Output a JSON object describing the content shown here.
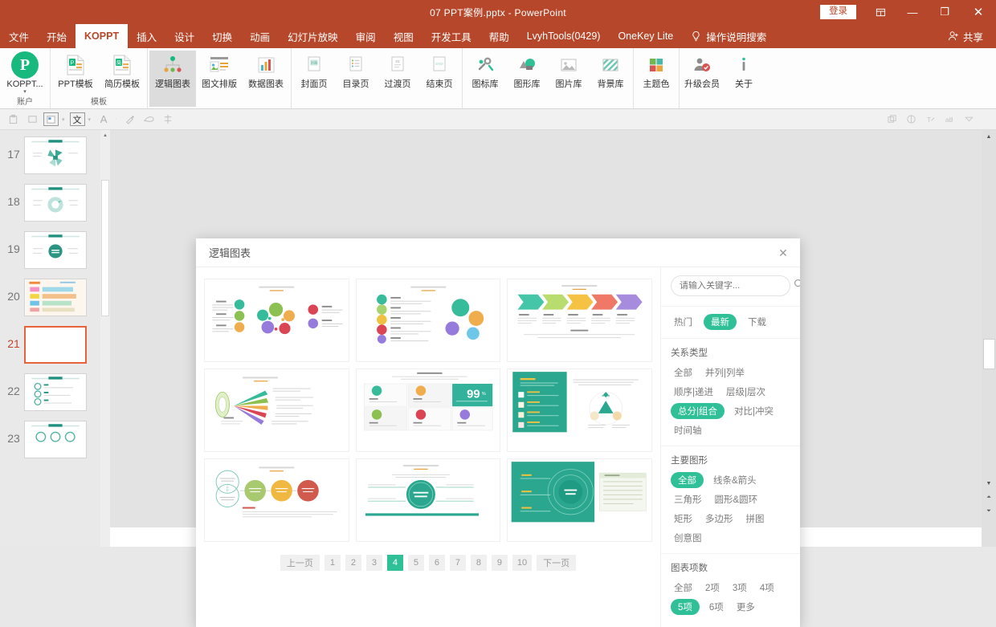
{
  "titlebar": {
    "document_title": "07  PPT案例.pptx  -  PowerPoint",
    "signin_label": "登录",
    "restore_icon": "restore-down-icon",
    "minimize_label": "—",
    "maximize_label": "❐",
    "close_label": "✕"
  },
  "menubar": {
    "items": [
      {
        "label": "文件",
        "active": false
      },
      {
        "label": "开始",
        "active": false
      },
      {
        "label": "KOPPT",
        "active": true
      },
      {
        "label": "插入",
        "active": false
      },
      {
        "label": "设计",
        "active": false
      },
      {
        "label": "切换",
        "active": false
      },
      {
        "label": "动画",
        "active": false
      },
      {
        "label": "幻灯片放映",
        "active": false
      },
      {
        "label": "审阅",
        "active": false
      },
      {
        "label": "视图",
        "active": false
      },
      {
        "label": "开发工具",
        "active": false
      },
      {
        "label": "帮助",
        "active": false
      },
      {
        "label": "LvyhTools(0429)",
        "active": false
      },
      {
        "label": "OneKey Lite",
        "active": false
      }
    ],
    "tell_me": "操作说明搜索",
    "tell_me_icon": "lightbulb-icon",
    "share_label": "共享",
    "share_icon": "share-person-icon"
  },
  "ribbon": {
    "groups": [
      {
        "label": "账户",
        "buttons": [
          {
            "label": "KOPPT...",
            "icon": "koppt-logo-icon",
            "has_caret": true,
            "selected": false
          }
        ]
      },
      {
        "label": "模板",
        "buttons": [
          {
            "label": "PPT模板",
            "icon": "ppt-template-icon",
            "selected": false
          },
          {
            "label": "简历模板",
            "icon": "resume-template-icon",
            "selected": false
          }
        ]
      },
      {
        "label": "",
        "buttons": [
          {
            "label": "逻辑图表",
            "icon": "logic-chart-icon",
            "selected": true
          },
          {
            "label": "图文排版",
            "icon": "text-image-layout-icon",
            "selected": false
          },
          {
            "label": "数据图表",
            "icon": "data-chart-icon",
            "selected": false
          }
        ]
      },
      {
        "label": "",
        "buttons": [
          {
            "label": "封面页",
            "icon": "cover-page-icon",
            "selected": false
          },
          {
            "label": "目录页",
            "icon": "toc-page-icon",
            "selected": false
          },
          {
            "label": "过渡页",
            "icon": "transition-page-icon",
            "selected": false
          },
          {
            "label": "结束页",
            "icon": "end-page-icon",
            "selected": false
          }
        ]
      },
      {
        "label": "",
        "buttons": [
          {
            "label": "图标库",
            "icon": "icon-library-icon",
            "selected": false
          },
          {
            "label": "图形库",
            "icon": "shape-library-icon",
            "selected": false
          },
          {
            "label": "图片库",
            "icon": "image-library-icon",
            "selected": false
          },
          {
            "label": "背景库",
            "icon": "background-library-icon",
            "selected": false
          }
        ]
      },
      {
        "label": "",
        "buttons": [
          {
            "label": "主题色",
            "icon": "theme-color-icon",
            "selected": false
          }
        ]
      },
      {
        "label": "",
        "buttons": [
          {
            "label": "升级会员",
            "icon": "upgrade-member-icon",
            "selected": false
          },
          {
            "label": "关于",
            "icon": "about-info-icon",
            "selected": false
          }
        ]
      }
    ]
  },
  "slides": [
    {
      "number": "17",
      "active": false,
      "style": "pie"
    },
    {
      "number": "18",
      "active": false,
      "style": "donut"
    },
    {
      "number": "19",
      "active": false,
      "style": "circle"
    },
    {
      "number": "20",
      "active": false,
      "style": "colorlist"
    },
    {
      "number": "21",
      "active": true,
      "style": "blank"
    },
    {
      "number": "22",
      "active": false,
      "style": "steps"
    },
    {
      "number": "23",
      "active": false,
      "style": "icons"
    }
  ],
  "dialog": {
    "title": "逻辑图表",
    "close_icon": "close-icon",
    "search": {
      "placeholder": "请输入关键字...",
      "value": "",
      "icon": "search-icon"
    },
    "sort_tabs": [
      {
        "label": "热门",
        "active": false
      },
      {
        "label": "最新",
        "active": true
      },
      {
        "label": "下载",
        "active": false
      }
    ],
    "filter_sections": [
      {
        "title": "关系类型",
        "options": [
          {
            "label": "全部",
            "active": false
          },
          {
            "label": "并列|列举",
            "active": false
          },
          {
            "label": "顺序|递进",
            "active": false
          },
          {
            "label": "层级|层次",
            "active": false
          },
          {
            "label": "总分|组合",
            "active": true
          },
          {
            "label": "对比|冲突",
            "active": false
          },
          {
            "label": "时间轴",
            "active": false
          }
        ]
      },
      {
        "title": "主要图形",
        "options": [
          {
            "label": "全部",
            "active": true
          },
          {
            "label": "线条&箭头",
            "active": false
          },
          {
            "label": "三角形",
            "active": false
          },
          {
            "label": "圆形&圆环",
            "active": false
          },
          {
            "label": "矩形",
            "active": false
          },
          {
            "label": "多边形",
            "active": false
          },
          {
            "label": "拼图",
            "active": false
          },
          {
            "label": "创意图",
            "active": false
          }
        ]
      },
      {
        "title": "图表项数",
        "options": [
          {
            "label": "全部",
            "active": false
          },
          {
            "label": "2项",
            "active": false
          },
          {
            "label": "3项",
            "active": false
          },
          {
            "label": "4项",
            "active": false
          },
          {
            "label": "5项",
            "active": true
          },
          {
            "label": "6项",
            "active": false
          },
          {
            "label": "更多",
            "active": false
          }
        ]
      }
    ],
    "templates": [
      {
        "name": "circle-cluster-diagram",
        "layout": "circles"
      },
      {
        "name": "icon-list-diagram",
        "layout": "iconlist"
      },
      {
        "name": "arrow-chevron-diagram",
        "layout": "arrows"
      },
      {
        "name": "fan-spread-diagram",
        "layout": "fan"
      },
      {
        "name": "four-quadrant-cards-diagram",
        "layout": "quadrant"
      },
      {
        "name": "teal-checklist-diagram",
        "layout": "tealpanel"
      },
      {
        "name": "venn-steps-diagram",
        "layout": "vennsteps"
      },
      {
        "name": "center-ring-diagram",
        "layout": "ring"
      },
      {
        "name": "teal-radial-diagram",
        "layout": "radial"
      }
    ],
    "pagination": {
      "prev_label": "上一页",
      "next_label": "下一页",
      "pages": [
        "1",
        "2",
        "3",
        "4",
        "5",
        "6",
        "7",
        "8",
        "9",
        "10"
      ],
      "current": "4"
    }
  },
  "colors": {
    "ribbon_accent": "#b7472a",
    "teal_accent": "#2fc098",
    "koppt_green": "#18b97f",
    "slide_selected_border": "#e8623c"
  }
}
